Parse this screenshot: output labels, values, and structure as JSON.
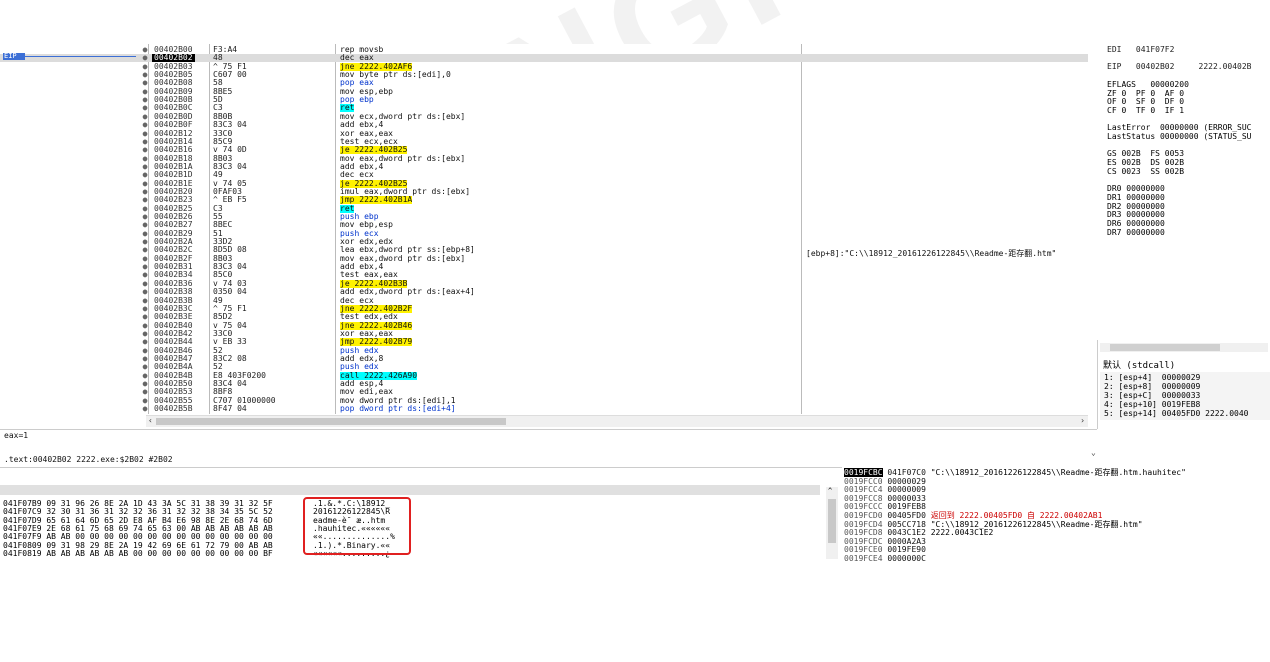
{
  "colors": {
    "eip_blue": "#3c6fd6",
    "jump_yellow": "#fff200",
    "ret_cyan": "#00ffff",
    "annotation_red": "#e02020"
  },
  "eip_label": "EIP",
  "disasm": [
    {
      "addr": "00402B00",
      "bytes": "F3:A4",
      "instr": "rep movsb"
    },
    {
      "addr": "00402B02",
      "bytes": "48",
      "instr": "dec eax"
    },
    {
      "addr": "00402B03",
      "bytes": "^ 75 F1",
      "instr": "jne 2222.402AF6"
    },
    {
      "addr": "00402B05",
      "bytes": "C607 00",
      "instr": "mov byte ptr ds:[edi],0"
    },
    {
      "addr": "00402B08",
      "bytes": "58",
      "instr": "pop eax"
    },
    {
      "addr": "00402B09",
      "bytes": "8BE5",
      "instr": "mov esp,ebp"
    },
    {
      "addr": "00402B0B",
      "bytes": "5D",
      "instr": "pop ebp"
    },
    {
      "addr": "00402B0C",
      "bytes": "C3",
      "instr": "ret"
    },
    {
      "addr": "00402B0D",
      "bytes": "8B0B",
      "instr": "mov ecx,dword ptr ds:[ebx]"
    },
    {
      "addr": "00402B0F",
      "bytes": "83C3 04",
      "instr": "add ebx,4"
    },
    {
      "addr": "00402B12",
      "bytes": "33C0",
      "instr": "xor eax,eax"
    },
    {
      "addr": "00402B14",
      "bytes": "85C9",
      "instr": "test ecx,ecx"
    },
    {
      "addr": "00402B16",
      "bytes": "v 74 0D",
      "instr": "je 2222.402B25"
    },
    {
      "addr": "00402B18",
      "bytes": "8B03",
      "instr": "mov eax,dword ptr ds:[ebx]"
    },
    {
      "addr": "00402B1A",
      "bytes": "83C3 04",
      "instr": "add ebx,4"
    },
    {
      "addr": "00402B1D",
      "bytes": "49",
      "instr": "dec ecx"
    },
    {
      "addr": "00402B1E",
      "bytes": "v 74 05",
      "instr": "je 2222.402B25"
    },
    {
      "addr": "00402B20",
      "bytes": "0FAF03",
      "instr": "imul eax,dword ptr ds:[ebx]"
    },
    {
      "addr": "00402B23",
      "bytes": "^ EB F5",
      "instr": "jmp 2222.402B1A"
    },
    {
      "addr": "00402B25",
      "bytes": "C3",
      "instr": "ret"
    },
    {
      "addr": "00402B26",
      "bytes": "55",
      "instr": "push ebp"
    },
    {
      "addr": "00402B27",
      "bytes": "8BEC",
      "instr": "mov ebp,esp"
    },
    {
      "addr": "00402B29",
      "bytes": "51",
      "instr": "push ecx"
    },
    {
      "addr": "00402B2A",
      "bytes": "33D2",
      "instr": "xor edx,edx"
    },
    {
      "addr": "00402B2C",
      "bytes": "8D5D 08",
      "instr": "lea ebx,dword ptr ss:[ebp+8]"
    },
    {
      "addr": "00402B2F",
      "bytes": "8B03",
      "instr": "mov eax,dword ptr ds:[ebx]"
    },
    {
      "addr": "00402B31",
      "bytes": "83C3 04",
      "instr": "add ebx,4"
    },
    {
      "addr": "00402B34",
      "bytes": "85C0",
      "instr": "test eax,eax"
    },
    {
      "addr": "00402B36",
      "bytes": "v 74 03",
      "instr": "je 2222.402B3B"
    },
    {
      "addr": "00402B38",
      "bytes": "0350 04",
      "instr": "add edx,dword ptr ds:[eax+4]"
    },
    {
      "addr": "00402B3B",
      "bytes": "49",
      "instr": "dec ecx"
    },
    {
      "addr": "00402B3C",
      "bytes": "^ 75 F1",
      "instr": "jne 2222.402B2F"
    },
    {
      "addr": "00402B3E",
      "bytes": "85D2",
      "instr": "test edx,edx"
    },
    {
      "addr": "00402B40",
      "bytes": "v 75 04",
      "instr": "jne 2222.402B46"
    },
    {
      "addr": "00402B42",
      "bytes": "33C0",
      "instr": "xor eax,eax"
    },
    {
      "addr": "00402B44",
      "bytes": "v EB 33",
      "instr": "jmp 2222.402B79"
    },
    {
      "addr": "00402B46",
      "bytes": "52",
      "instr": "push edx"
    },
    {
      "addr": "00402B47",
      "bytes": "83C2 08",
      "instr": "add edx,8"
    },
    {
      "addr": "00402B4A",
      "bytes": "52",
      "instr": "push edx"
    },
    {
      "addr": "00402B4B",
      "bytes": "E8 403F0200",
      "instr": "call 2222.426A90"
    },
    {
      "addr": "00402B50",
      "bytes": "83C4 04",
      "instr": "add esp,4"
    },
    {
      "addr": "00402B53",
      "bytes": "8BF8",
      "instr": "mov edi,eax"
    },
    {
      "addr": "00402B55",
      "bytes": "C707 01000000",
      "instr": "mov dword ptr ds:[edi],1"
    },
    {
      "addr": "00402B5B",
      "bytes": "8F47 04",
      "instr": "pop dword ptr ds:[edi+4]"
    }
  ],
  "comment": "[ebp+8]:\"C:\\\\18912_20161226122845\\\\Readme-距存翻.htm\"",
  "info": {
    "line1": "eax=1",
    "line2": ".text:00402B02 2222.exe:$2B02 #2B02"
  },
  "registers": [
    "EDI   041F07F2",
    "",
    "EIP   00402B02     2222.00402B",
    "",
    "EFLAGS   00000200",
    "ZF 0  PF 0  AF 0",
    "OF 0  SF 0  DF 0",
    "CF 0  TF 0  IF 1",
    "",
    "LastError  00000000 (ERROR_SUC",
    "LastStatus 00000000 (STATUS_SU",
    "",
    "GS 002B  FS 0053",
    "ES 002B  DS 002B",
    "CS 0023  SS 002B",
    "",
    "DR0 00000000",
    "DR1 00000000",
    "DR2 00000000",
    "DR3 00000000",
    "DR6 00000000",
    "DR7 00000000"
  ],
  "stack_title": "默认 (stdcall)",
  "stack_args": [
    "1: [esp+4]  00000029",
    "2: [esp+8]  00000009",
    "3: [esp+C]  00000033",
    "4: [esp+10] 0019FEB8",
    "5: [esp+14] 00405FD0 2222.0040"
  ],
  "dump": [
    {
      "hex": "041F07B9 09 31 96 26 8E 2A 1D 43 3A 5C 31 38 39 31 32 5F",
      "ascii": ".1.&.*.C:\\18912_"
    },
    {
      "hex": "041F07C9 32 30 31 36 31 32 32 36 31 32 32 38 34 35 5C 52",
      "ascii": "20161226122845\\R"
    },
    {
      "hex": "041F07D9 65 61 64 6D 65 2D E8 AF B4 E6 98 8E 2E 68 74 6D",
      "ascii": "eadme-è¯ æ..htm"
    },
    {
      "hex": "041F07E9 2E 68 61 75 68 69 74 65 63 00 AB AB AB AB AB AB",
      "ascii": ".hauhitec.««««««"
    },
    {
      "hex": "041F07F9 AB AB 00 00 00 00 00 00 00 00 00 00 00 00 00 00",
      "ascii": "««..............%"
    },
    {
      "hex": "041F0809 09 31 98 29 8E 2A 19 42 69 6E 61 72 79 00 AB AB",
      "ascii": ".1.).*.Binary.««"
    },
    {
      "hex": "041F0819 AB AB AB AB AB AB 00 00 00 00 00 00 00 00 00 BF",
      "ascii": "««««««.........¿"
    }
  ],
  "stack": [
    {
      "addr": "0019FCBC",
      "val": "041F07C0",
      "cmt": "\"C:\\\\18912_20161226122845\\\\Readme-距存翻.htm.hauhitec\""
    },
    {
      "addr": "0019FCC0",
      "val": "00000029",
      "cmt": ""
    },
    {
      "addr": "0019FCC4",
      "val": "00000009",
      "cmt": ""
    },
    {
      "addr": "0019FCC8",
      "val": "00000033",
      "cmt": ""
    },
    {
      "addr": "0019FCCC",
      "val": "0019FEB8",
      "cmt": ""
    },
    {
      "addr": "0019FCD0",
      "val": "00405FD0",
      "cmt": "返回到 2222.00405FD0 自 2222.00402AB1"
    },
    {
      "addr": "0019FCD4",
      "val": "005CC718",
      "cmt": "\"C:\\\\18912_20161226122845\\\\Readme-距存翻.htm\""
    },
    {
      "addr": "0019FCD8",
      "val": "0043C1E2",
      "cmt": "2222.0043C1E2"
    },
    {
      "addr": "0019FCDC",
      "val": "0000A2A3",
      "cmt": ""
    },
    {
      "addr": "0019FCE0",
      "val": "0019FE90",
      "cmt": ""
    },
    {
      "addr": "0019FCE4",
      "val": "0000000C",
      "cmt": ""
    }
  ],
  "watermark": "SANGFOR"
}
